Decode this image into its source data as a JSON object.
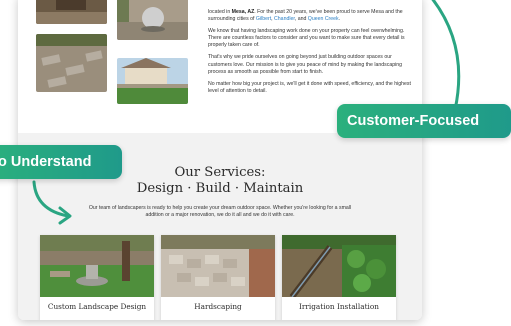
{
  "website": {
    "about": {
      "p1_pre": "located in ",
      "p1_bold": "Mesa, AZ",
      "p1_mid": ". For the past 20 years, we've been proud to serve Mesa and the surrounding cities of ",
      "p1_link1": "Gilbert",
      "p1_sep1": ", ",
      "p1_link2": "Chandler",
      "p1_sep2": ", and ",
      "p1_link3": "Queen Creek",
      "p1_end": ".",
      "p2": "We know that having landscaping work done on your property can feel overwhelming. There are countless factors to consider and you want to make sure that every detail is properly taken care of.",
      "p3": "That's why we pride ourselves on going beyond just building outdoor spaces our customers love. Our mission is to give you peace of mind by making the landscaping process as smooth as possible from start to finish.",
      "p4": "No matter how big your project is, we'll get it done with speed, efficiency, and the highest level of attention to detail."
    },
    "services": {
      "title": "Our Services:",
      "subtitle": "Design · Build · Maintain",
      "description": "Our team of landscapers is ready to help you create your dream outdoor space. Whether you're looking for a small addition or a major renovation, we do it all and we do it with care.",
      "items": [
        {
          "label": "Custom Landscape Design"
        },
        {
          "label": "Hardscaping"
        },
        {
          "label": "Irrigation Installation"
        }
      ]
    }
  },
  "overlays": {
    "left_badge": "o Understand",
    "right_badge": "Customer-Focused"
  },
  "colors": {
    "badge_start": "#2bb07d",
    "badge_end": "#1f9a8a",
    "link": "#2a7fc4",
    "services_bg": "#f2f2f2"
  }
}
